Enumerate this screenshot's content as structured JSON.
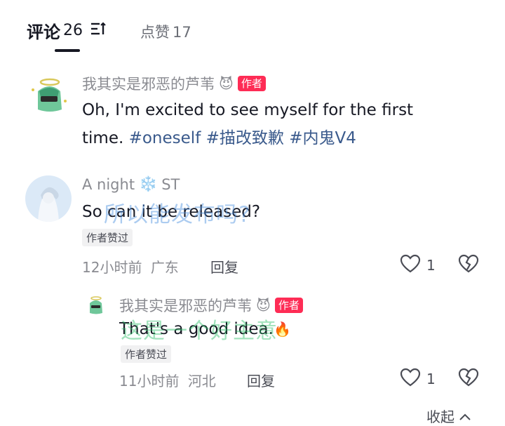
{
  "tabs": {
    "comments_label": "评论",
    "comments_count": "26",
    "likes_label": "点赞",
    "likes_count": "17"
  },
  "comments": [
    {
      "username": "我其实是邪恶的芦苇",
      "badge": "作者",
      "text": "Oh, I'm excited to see myself for the first",
      "text_line2": "time.",
      "hashtags": [
        "#oneself",
        "#描改致歉",
        "#内鬼V4"
      ]
    },
    {
      "username": "A night",
      "username_suffix": "ST",
      "text": "So can it be released?",
      "overlay": "所以能发布吗?",
      "liked_tag": "作者赞过",
      "time": "12小时前",
      "location": "广东",
      "reply_label": "回复",
      "likes": "1"
    },
    {
      "username": "我其实是邪恶的芦苇",
      "badge": "作者",
      "text": "That's a good idea.",
      "overlay": "这是一个好主意",
      "liked_tag": "作者赞过",
      "time": "11小时前",
      "location": "河北",
      "reply_label": "回复",
      "likes": "1"
    }
  ],
  "collapse_label": "收起",
  "colors": {
    "accent_red": "#fe2c55",
    "hashtag": "#3a5a8c",
    "overlay_blue": "#4a8fe0",
    "overlay_green": "#2fbf6a"
  }
}
